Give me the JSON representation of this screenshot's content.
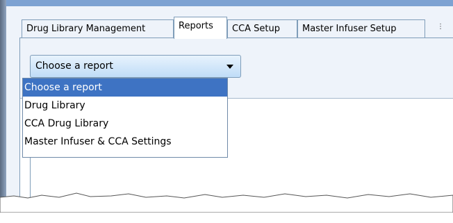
{
  "tabs": [
    {
      "label": "Drug Library Management",
      "active": false
    },
    {
      "label": "Reports",
      "active": true
    },
    {
      "label": "CCA Setup",
      "active": false
    },
    {
      "label": "Master Infuser Setup",
      "active": false
    }
  ],
  "report_select": {
    "value": "Choose a report",
    "options": [
      "Choose a report",
      "Drug Library",
      "CCA Drug Library",
      "Master Infuser & CCA Settings"
    ],
    "selected_index": 0
  },
  "colors": {
    "selection": "#3e73c3",
    "window_bg": "#eef3fa",
    "border": "#7f9db9"
  }
}
